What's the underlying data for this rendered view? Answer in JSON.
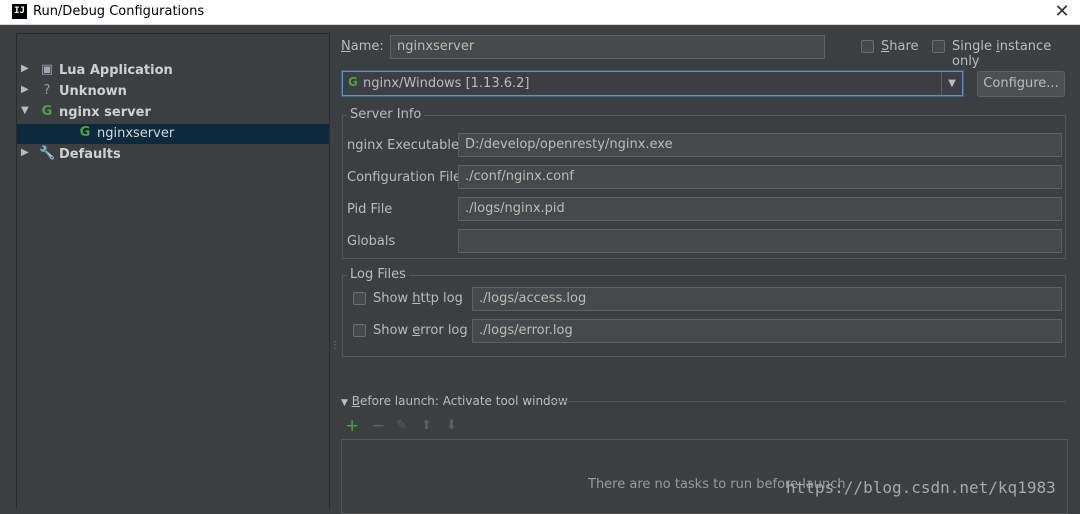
{
  "window": {
    "title": "Run/Debug Configurations",
    "app_icon_text": "IJ",
    "close_glyph": "✕"
  },
  "toolbar": [
    {
      "name": "add-icon",
      "glyph": "+",
      "color": "#4aa43b"
    },
    {
      "name": "remove-icon",
      "glyph": "−",
      "color": "#d9534f"
    },
    {
      "name": "copy-icon",
      "glyph": "⎘",
      "color": "#9aa7b0"
    },
    {
      "name": "wrench-icon",
      "glyph": "🔧",
      "color": "#9aa7b0"
    },
    {
      "name": "move-up-icon",
      "glyph": "⬆",
      "color": "#6a6a6a"
    },
    {
      "name": "move-down-icon",
      "glyph": "⬇",
      "color": "#6a6a6a"
    },
    {
      "name": "folder-icon",
      "glyph": "■",
      "color": "#9aa7b0"
    },
    {
      "name": "sort-icon",
      "glyph": "↓",
      "color": "#6a6a6a"
    }
  ],
  "tree": [
    {
      "name": "tree-item-lua-application",
      "label": "Lua Application",
      "icon": "lua-icon",
      "glyph": "▣",
      "expanded": false,
      "indent": 0
    },
    {
      "name": "tree-item-unknown",
      "label": "Unknown",
      "icon": "question-icon",
      "glyph": "?",
      "expanded": false,
      "indent": 0
    },
    {
      "name": "tree-item-nginx-server",
      "label": "nginx server",
      "icon": "nginx-icon",
      "glyph": "G",
      "expanded": true,
      "indent": 0
    },
    {
      "name": "tree-item-nginxserver",
      "label": "nginxserver",
      "icon": "nginx-icon",
      "glyph": "G",
      "expanded": null,
      "indent": 1,
      "selected": true
    },
    {
      "name": "tree-item-defaults",
      "label": "Defaults",
      "icon": "wrench-icon",
      "glyph": "🔧",
      "expanded": false,
      "indent": 0
    }
  ],
  "form": {
    "name_label_prefix": "N",
    "name_label_rest": "ame:",
    "name_value": "nginxserver",
    "share_label_prefix": "S",
    "share_label_rest": "hare",
    "single_instance_before": "Single ",
    "single_instance_u": "i",
    "single_instance_after": "nstance only",
    "nginx_select": "nginx/Windows [1.13.6.2]",
    "configure_button": "Configure..."
  },
  "server_info": {
    "title": "Server Info",
    "rows": [
      {
        "label": "nginx Executable",
        "value": "D:/develop/openresty/nginx.exe"
      },
      {
        "label": "Configuration File",
        "value": "./conf/nginx.conf"
      },
      {
        "label": "Pid File",
        "value": "./logs/nginx.pid"
      },
      {
        "label": "Globals",
        "value": ""
      }
    ]
  },
  "log_files": {
    "title": "Log Files",
    "http_label_before": "Show ",
    "http_label_u": "h",
    "http_label_after": "ttp log",
    "http_value": "./logs/access.log",
    "error_label_before": "Show ",
    "error_label_u": "e",
    "error_label_after": "rror log",
    "error_value": "./logs/error.log"
  },
  "before_launch": {
    "title_u": "B",
    "title_rest": "efore launch: Activate tool window",
    "empty_text": "There are no tasks to run before launch"
  },
  "watermark": "https://blog.csdn.net/kq1983"
}
